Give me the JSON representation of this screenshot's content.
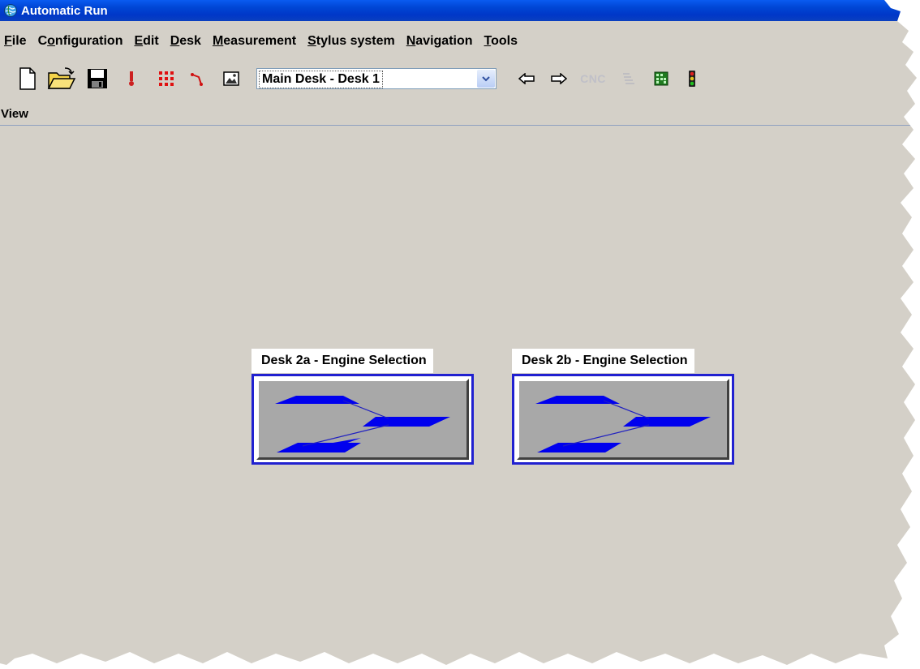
{
  "window": {
    "title": "Automatic Run"
  },
  "menu": [
    {
      "pre": "",
      "key": "F",
      "post": "ile"
    },
    {
      "pre": "C",
      "key": "o",
      "post": "nfiguration"
    },
    {
      "pre": "",
      "key": "E",
      "post": "dit"
    },
    {
      "pre": "",
      "key": "D",
      "post": "esk"
    },
    {
      "pre": "",
      "key": "M",
      "post": "easurement"
    },
    {
      "pre": "",
      "key": "S",
      "post": "tylus system"
    },
    {
      "pre": "",
      "key": "N",
      "post": "avigation"
    },
    {
      "pre": "",
      "key": "T",
      "post": "ools"
    }
  ],
  "toolbar": {
    "desk_select": "Main Desk - Desk 1",
    "cnc_label": "CNC"
  },
  "view_label": "View",
  "desks": [
    {
      "label": "Desk 2a - Engine Selection"
    },
    {
      "label": "Desk 2b - Engine Selection"
    }
  ],
  "colors": {
    "titlebar": "#0046d5",
    "desk_shape": "#0000ee",
    "desk_border": "#2020d0",
    "background": "#d4d0c8"
  }
}
